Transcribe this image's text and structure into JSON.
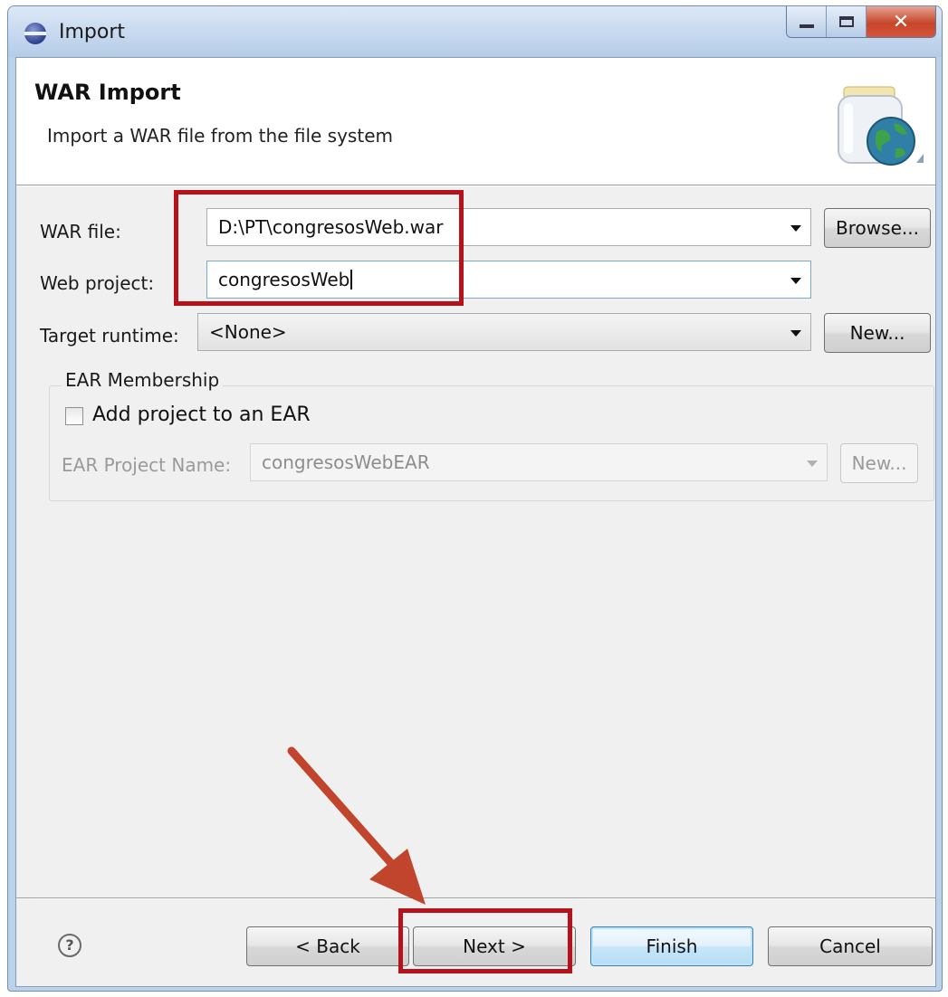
{
  "window": {
    "title": "Import"
  },
  "header": {
    "title": "WAR Import",
    "description": "Import a WAR file from the file system"
  },
  "form": {
    "war_file": {
      "label": "WAR file:",
      "value": "D:\\PT\\congresosWeb.war"
    },
    "browse_label": "Browse...",
    "web_project": {
      "label": "Web project:",
      "value": "congresosWeb"
    },
    "target_runtime": {
      "label": "Target runtime:",
      "value": "<None>"
    },
    "runtime_new_label": "New..."
  },
  "ear": {
    "group_label": "EAR Membership",
    "checkbox_label": "Add project to an EAR",
    "checkbox_checked": false,
    "project_name_label": "EAR Project Name:",
    "project_name_value": "congresosWebEAR",
    "new_label": "New..."
  },
  "footer": {
    "back_label": "< Back",
    "next_label": "Next >",
    "finish_label": "Finish",
    "cancel_label": "Cancel"
  },
  "icons": [
    "app-icon",
    "war-jar-globe-icon",
    "help-icon",
    "dropdown-arrow-icon"
  ],
  "colors": {
    "annotation": "#b5121b",
    "arrow": "#c0452c",
    "default_button": "#3c7fb1"
  }
}
